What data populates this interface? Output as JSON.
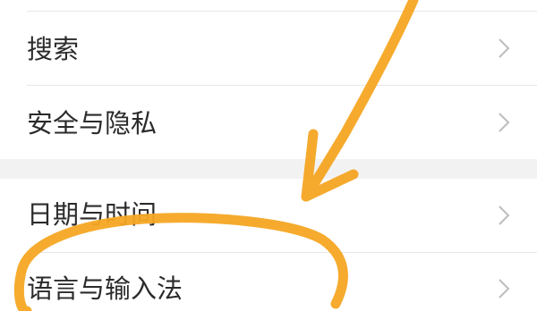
{
  "settings": {
    "items": [
      {
        "label": "搜索",
        "icon": "chevron-right-icon"
      },
      {
        "label": "安全与隐私",
        "icon": "chevron-right-icon"
      },
      {
        "label": "日期与时间",
        "icon": "chevron-right-icon"
      },
      {
        "label": "语言与输入法",
        "icon": "chevron-right-icon"
      }
    ]
  },
  "colors": {
    "background": "#ffffff",
    "section_gap": "#f2f2f2",
    "divider": "#e6e6e6",
    "text": "#2b2b2b",
    "chevron": "#bdbdbd",
    "annotation": "#f5a623"
  }
}
